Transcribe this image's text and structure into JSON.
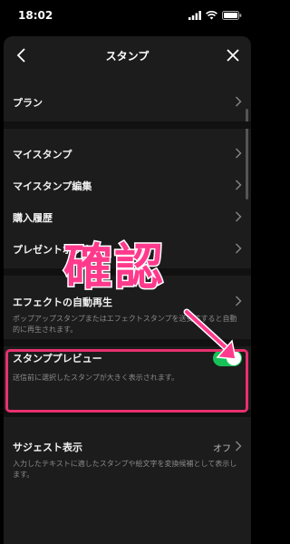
{
  "status": {
    "time": "18:02"
  },
  "nav": {
    "title": "スタンプ"
  },
  "rows": {
    "plan": {
      "label": "プラン"
    },
    "my_stamp": {
      "label": "マイスタンプ"
    },
    "my_stamp_edit": {
      "label": "マイスタンプ編集"
    },
    "purchase_history": {
      "label": "購入履歴"
    },
    "present_box": {
      "label": "プレゼントボックス"
    },
    "effect_autoplay": {
      "label": "エフェクトの自動再生",
      "desc": "ポップアップスタンプまたはエフェクトスタンプを送受信すると自動的に再生されます。"
    },
    "stamp_preview": {
      "label": "スタンププレビュー",
      "desc": "送信前に選択したスタンプが大きく表示されます。",
      "enabled": true
    },
    "suggest": {
      "label": "サジェスト表示",
      "value": "オフ",
      "desc": "入力したテキストに適したスタンプや絵文字を変換候補として表示します。"
    }
  },
  "annotation": {
    "text": "確認"
  },
  "colors": {
    "toggle_on": "#18c158",
    "highlight": "#e8306f",
    "annotation": "#ff3a8c"
  }
}
